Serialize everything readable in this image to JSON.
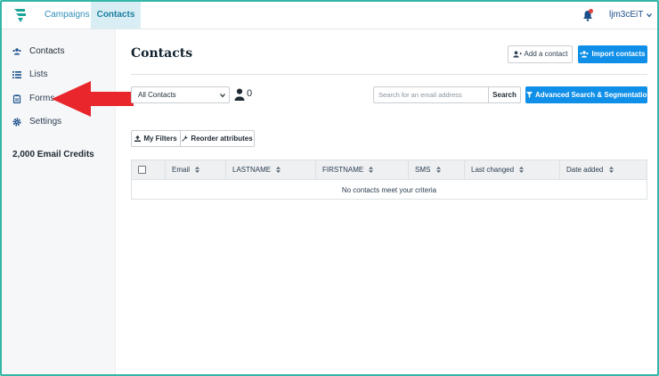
{
  "topbar": {
    "tabs": [
      {
        "label": "Campaigns"
      },
      {
        "label": "Contacts"
      }
    ],
    "user": "ljm3cEiT",
    "colors": {
      "accent": "#2f8fb8",
      "active_tab_bg": "#d9eef4",
      "notification_dot": "#e0413b"
    }
  },
  "sidebar": {
    "items": [
      {
        "label": "Contacts",
        "icon": "users-icon"
      },
      {
        "label": "Lists",
        "icon": "list-icon"
      },
      {
        "label": "Forms",
        "icon": "clipboard-icon"
      },
      {
        "label": "Settings",
        "icon": "gear-icon"
      }
    ],
    "credits": "2,000 Email Credits"
  },
  "main": {
    "title": "Contacts",
    "add_contact": "Add a contact",
    "import_contacts": "Import contacts",
    "list_select": "All Contacts",
    "contact_count": "0",
    "search_placeholder": "Search for an email address",
    "search_button": "Search",
    "advanced_button": "Advanced Search & Segmentation",
    "my_filters": "My Filters",
    "reorder_attributes": "Reorder attributes",
    "table": {
      "columns": [
        "Email",
        "LASTNAME",
        "FIRSTNAME",
        "SMS",
        "Last changed",
        "Date added"
      ],
      "empty_message": "No contacts meet your criteria"
    },
    "colors": {
      "primary_button": "#0f8fe8",
      "annotation_arrow": "#e8262b"
    }
  }
}
